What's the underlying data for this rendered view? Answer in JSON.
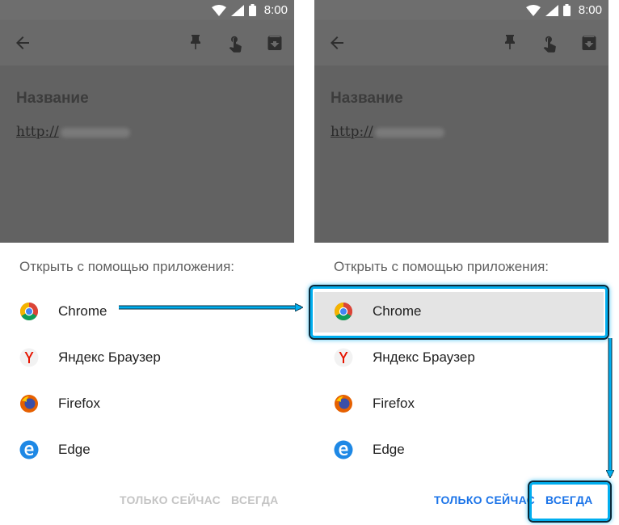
{
  "status": {
    "time": "8:00",
    "icons": [
      "wifi-icon",
      "signal-icon",
      "battery-icon"
    ]
  },
  "toolbar": {
    "icons": [
      "back-arrow-icon",
      "pin-icon",
      "touch-icon",
      "archive-icon"
    ]
  },
  "note": {
    "title": "Название",
    "link_prefix": "http://"
  },
  "sheet": {
    "title": "Открыть с помощью приложения:",
    "apps": [
      {
        "label": "Chrome",
        "icon": "chrome-icon"
      },
      {
        "label": "Яндекс Браузер",
        "icon": "yandex-icon"
      },
      {
        "label": "Firefox",
        "icon": "firefox-icon"
      },
      {
        "label": "Edge",
        "icon": "edge-icon"
      }
    ],
    "just_once": "ТОЛЬКО СЕЙЧАС",
    "always": "ВСЕГДА"
  },
  "colors": {
    "accent": "#1a73e8",
    "disabled": "#bdbdbd",
    "callout": "#00aeef",
    "scrim": "#626262"
  },
  "state": {
    "left_selected_app": null,
    "right_selected_app": "Chrome",
    "left_buttons_enabled": false,
    "right_buttons_enabled": true
  }
}
